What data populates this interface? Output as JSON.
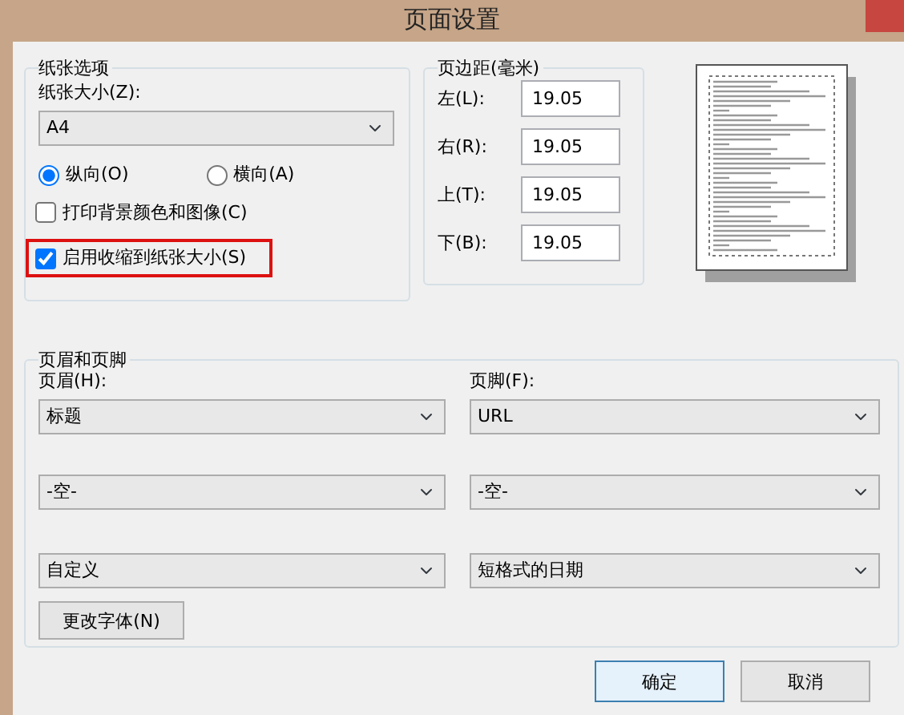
{
  "window": {
    "title": "页面设置"
  },
  "paper_options": {
    "title": "纸张选项",
    "size_label": "纸张大小(Z):",
    "size": "A4",
    "orientation": [
      {
        "label": "纵向(O)",
        "selected": true
      },
      {
        "label": "横向(A)",
        "selected": false
      }
    ],
    "options": [
      {
        "label": "打印背景颜色和图像(C)",
        "checked": false,
        "highlighted": false
      },
      {
        "label": "启用收缩到纸张大小(S)",
        "checked": true,
        "highlighted": true
      }
    ]
  },
  "margins": {
    "title": "页边距(毫米)",
    "fields": [
      {
        "label": "左(L):",
        "value": "19.05"
      },
      {
        "label": "右(R):",
        "value": "19.05"
      },
      {
        "label": "上(T):",
        "value": "19.05"
      },
      {
        "label": "下(B):",
        "value": "19.05"
      }
    ]
  },
  "header_footer": {
    "title": "页眉和页脚",
    "header_label": "页眉(H):",
    "footer_label": "页脚(F):",
    "header": [
      "标题",
      "-空-",
      "自定义"
    ],
    "footer": [
      "URL",
      "-空-",
      "短格式的日期"
    ],
    "font_button": "更改字体(N)"
  },
  "buttons": [
    "确定",
    "取消"
  ]
}
